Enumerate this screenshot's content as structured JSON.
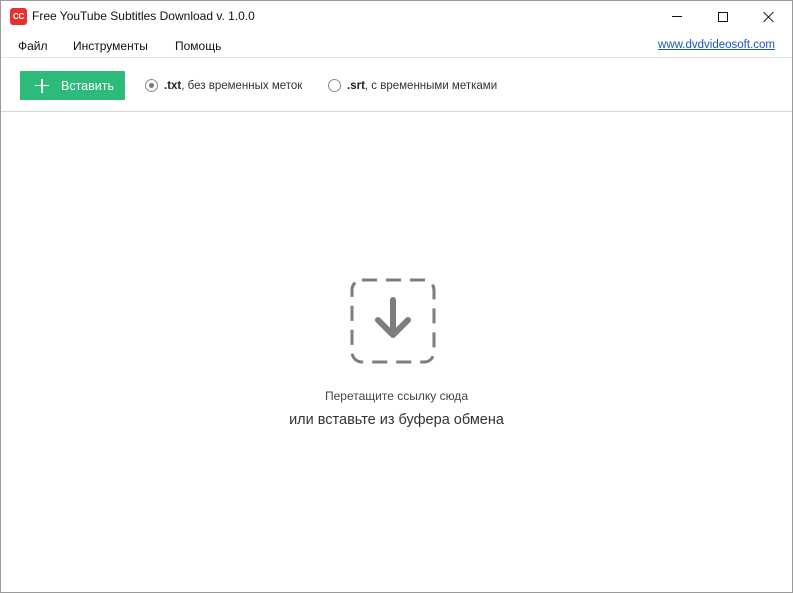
{
  "window": {
    "title": "Free YouTube Subtitles Download v. 1.0.0",
    "logo_text": "CC"
  },
  "menu": {
    "items": [
      "Файл",
      "Инструменты",
      "Помощь"
    ],
    "link": "www.dvdvideosoft.com"
  },
  "toolbar": {
    "paste_label": "Вставить",
    "options": [
      {
        "ext": ".txt",
        "desc": ", без временных меток",
        "selected": true
      },
      {
        "ext": ".srt",
        "desc": ", с временными метками",
        "selected": false
      }
    ]
  },
  "drop": {
    "line1": "Перетащите ссылку сюда",
    "line2": "или вставьте из буфера обмена"
  },
  "colors": {
    "accent": "#2dbb7a",
    "logo": "#e8312f",
    "link": "#1a55c5",
    "icon": "#7d7d7d"
  }
}
